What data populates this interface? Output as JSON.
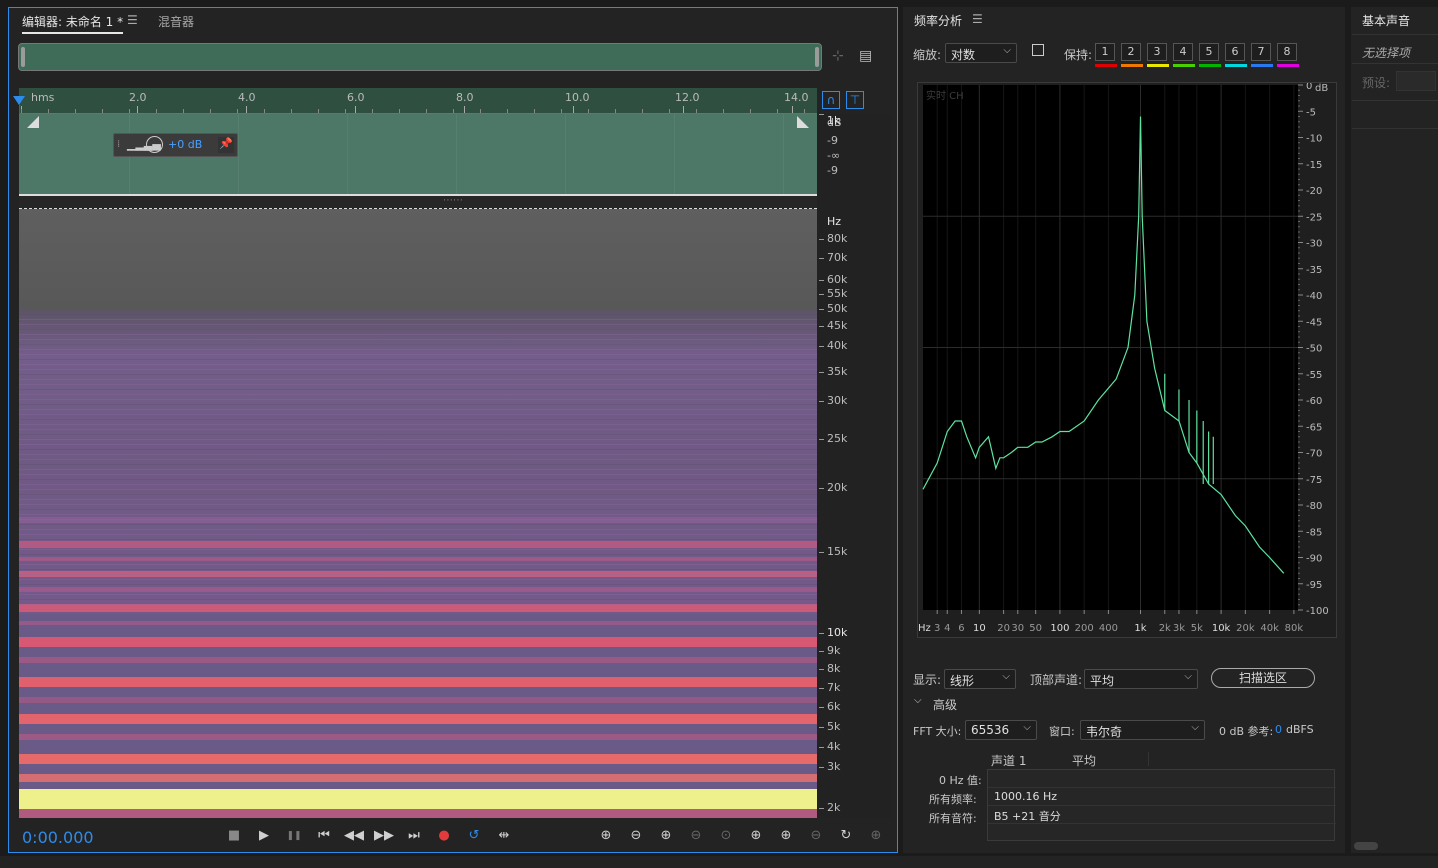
{
  "editor": {
    "tabs": [
      {
        "label": "编辑器: 未命名 1 *"
      },
      {
        "label": "混音器"
      }
    ],
    "time_display": "0:00.000",
    "ruler_labels": [
      "hms",
      "2.0",
      "4.0",
      "6.0",
      "8.0",
      "10.0",
      "12.0",
      "14.0"
    ],
    "hud_gain": "+0 dB",
    "db_scale": [
      "dB",
      "-9",
      "-∞",
      "-9"
    ],
    "hz_scale": [
      "Hz",
      "80k",
      "70k",
      "60k",
      "55k",
      "50k",
      "45k",
      "40k",
      "35k",
      "30k",
      "25k",
      "20k",
      "15k",
      "10k",
      "9k",
      "8k",
      "7k",
      "6k",
      "5k",
      "4k",
      "3k",
      "2k",
      "1k"
    ],
    "transport_icons": [
      "stop-icon",
      "play-icon",
      "pause-icon",
      "skip-start-icon",
      "rewind-icon",
      "fast-forward-icon",
      "skip-end-icon",
      "record-icon",
      "loop-icon",
      "skip-selection-icon"
    ],
    "zoom_icons": [
      "zoom-in-amplitude-icon",
      "zoom-out-amplitude-icon",
      "zoom-in-time-icon",
      "zoom-out-time-icon",
      "zoom-full-icon",
      "zoom-in-left-icon",
      "zoom-in-right-icon",
      "zoom-selection-icon",
      "zoom-reset-icon",
      "zoom-frequency-icon"
    ]
  },
  "freq": {
    "title": "频率分析",
    "zoom_label": "缩放:",
    "zoom_value": "对数",
    "hold_label": "保持:",
    "hold_buttons": [
      "1",
      "2",
      "3",
      "4",
      "5",
      "6",
      "7",
      "8"
    ],
    "hold_colors": [
      "#e00000",
      "#f07800",
      "#e8e800",
      "#48d000",
      "#00b400",
      "#00d8e0",
      "#2878f0",
      "#e000e0"
    ],
    "plot_label": "实时 CH",
    "display_label": "显示:",
    "display_value": "线形",
    "top_channel_label": "顶部声道:",
    "top_channel_value": "平均",
    "scan_button": "扫描选区",
    "advanced_label": "高级",
    "fft_label": "FFT 大小:",
    "fft_value": "65536",
    "window_label": "窗口:",
    "window_value": "韦尔奇",
    "ref_label": "0 dB 参考:",
    "ref_value": "0",
    "ref_unit": "dBFS",
    "col_channel1": "声道 1",
    "col_average": "平均",
    "row_0hz": "0 Hz 值:",
    "row_all_freq": "所有频率:",
    "row_all_note": "所有音符:",
    "val_all_freq": "1000.16 Hz",
    "val_all_note": "B5 +21 音分"
  },
  "sound": {
    "title": "基本声音",
    "no_selection": "无选择项",
    "preset_label": "预设:"
  },
  "chart_data": {
    "type": "line",
    "x_scale": "log",
    "xlabel": "Hz",
    "ylabel": "dB",
    "x_ticks": [
      "3",
      "4",
      "6",
      "10",
      "20",
      "30",
      "50",
      "100",
      "200",
      "400",
      "1k",
      "2k",
      "3k",
      "5k",
      "10k",
      "20k",
      "40k",
      "80k"
    ],
    "y_ticks": [
      "0",
      "-5",
      "-10",
      "-15",
      "-20",
      "-25",
      "-30",
      "-35",
      "-40",
      "-45",
      "-50",
      "-55",
      "-60",
      "-65",
      "-70",
      "-75",
      "-80",
      "-85",
      "-90",
      "-95",
      "-100"
    ],
    "ylim": [
      -100,
      0
    ],
    "series": [
      {
        "color": "#5ee2a0",
        "points": [
          [
            2,
            -77
          ],
          [
            3,
            -72
          ],
          [
            4,
            -66
          ],
          [
            5,
            -64
          ],
          [
            6,
            -64
          ],
          [
            7,
            -67
          ],
          [
            9,
            -71
          ],
          [
            10,
            -69
          ],
          [
            13,
            -67
          ],
          [
            16,
            -73
          ],
          [
            18,
            -71
          ],
          [
            20,
            -71
          ],
          [
            25,
            -70
          ],
          [
            30,
            -69
          ],
          [
            40,
            -69
          ],
          [
            50,
            -68
          ],
          [
            60,
            -68
          ],
          [
            80,
            -67
          ],
          [
            100,
            -66
          ],
          [
            130,
            -66
          ],
          [
            200,
            -64
          ],
          [
            300,
            -60
          ],
          [
            500,
            -56
          ],
          [
            700,
            -50
          ],
          [
            850,
            -40
          ],
          [
            950,
            -25
          ],
          [
            1000,
            -6
          ],
          [
            1050,
            -25
          ],
          [
            1200,
            -45
          ],
          [
            1500,
            -54
          ],
          [
            2000,
            -62
          ],
          [
            3000,
            -64
          ],
          [
            4000,
            -70
          ],
          [
            5000,
            -72
          ],
          [
            7000,
            -76
          ],
          [
            10000,
            -78
          ],
          [
            15000,
            -82
          ],
          [
            20000,
            -84
          ],
          [
            30000,
            -88
          ],
          [
            40000,
            -90
          ],
          [
            60000,
            -93
          ]
        ]
      }
    ],
    "harmonic_spikes": [
      [
        2000,
        -55
      ],
      [
        3000,
        -58
      ],
      [
        4000,
        -60
      ],
      [
        5000,
        -62
      ],
      [
        6000,
        -64
      ],
      [
        7000,
        -66
      ],
      [
        8000,
        -67
      ]
    ]
  }
}
